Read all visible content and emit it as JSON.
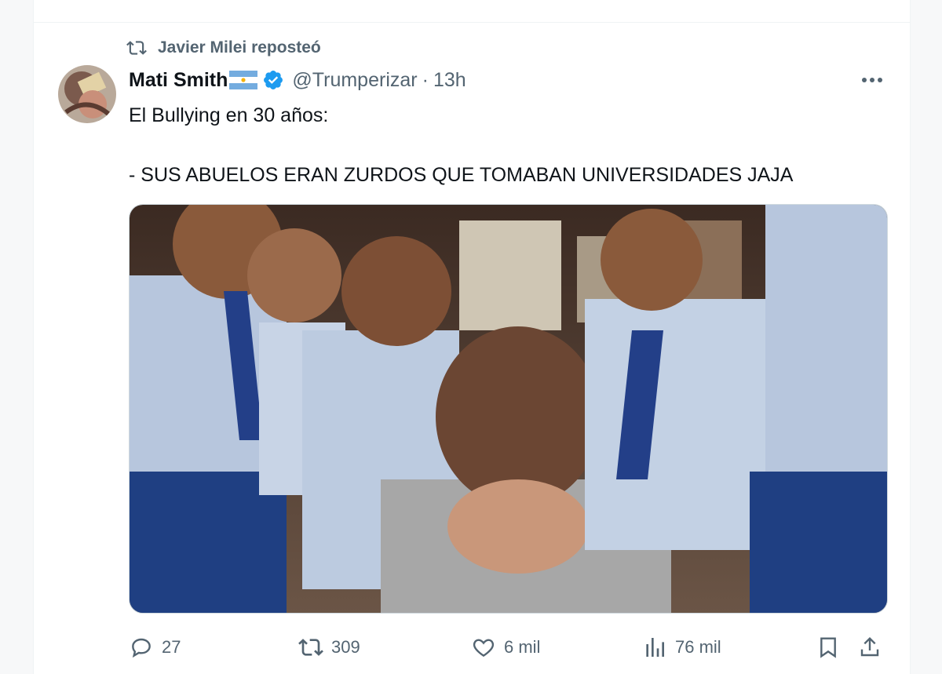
{
  "repost": {
    "label": "Javier Milei reposteó"
  },
  "tweet": {
    "name": "Mati Smith",
    "handle": "@Trumperizar",
    "separator": "·",
    "time": "13h",
    "line1": "El Bullying en 30 años:",
    "line2": "- SUS ABUELOS ERAN ZURDOS QUE TOMABAN UNIVERSIDADES JAJA"
  },
  "actions": {
    "replies": "27",
    "reposts": "309",
    "likes": "6 mil",
    "views": "76 mil"
  },
  "icons": {
    "repost": "repost-icon",
    "verified": "verified-badge-icon",
    "flag": "argentina-flag-icon",
    "more": "more-icon",
    "reply": "reply-icon",
    "like": "heart-icon",
    "views": "views-icon",
    "bookmark": "bookmark-icon",
    "share": "share-icon"
  },
  "colors": {
    "verified": "#1d9bf0",
    "meta_text": "#536471",
    "text": "#0f1419"
  }
}
